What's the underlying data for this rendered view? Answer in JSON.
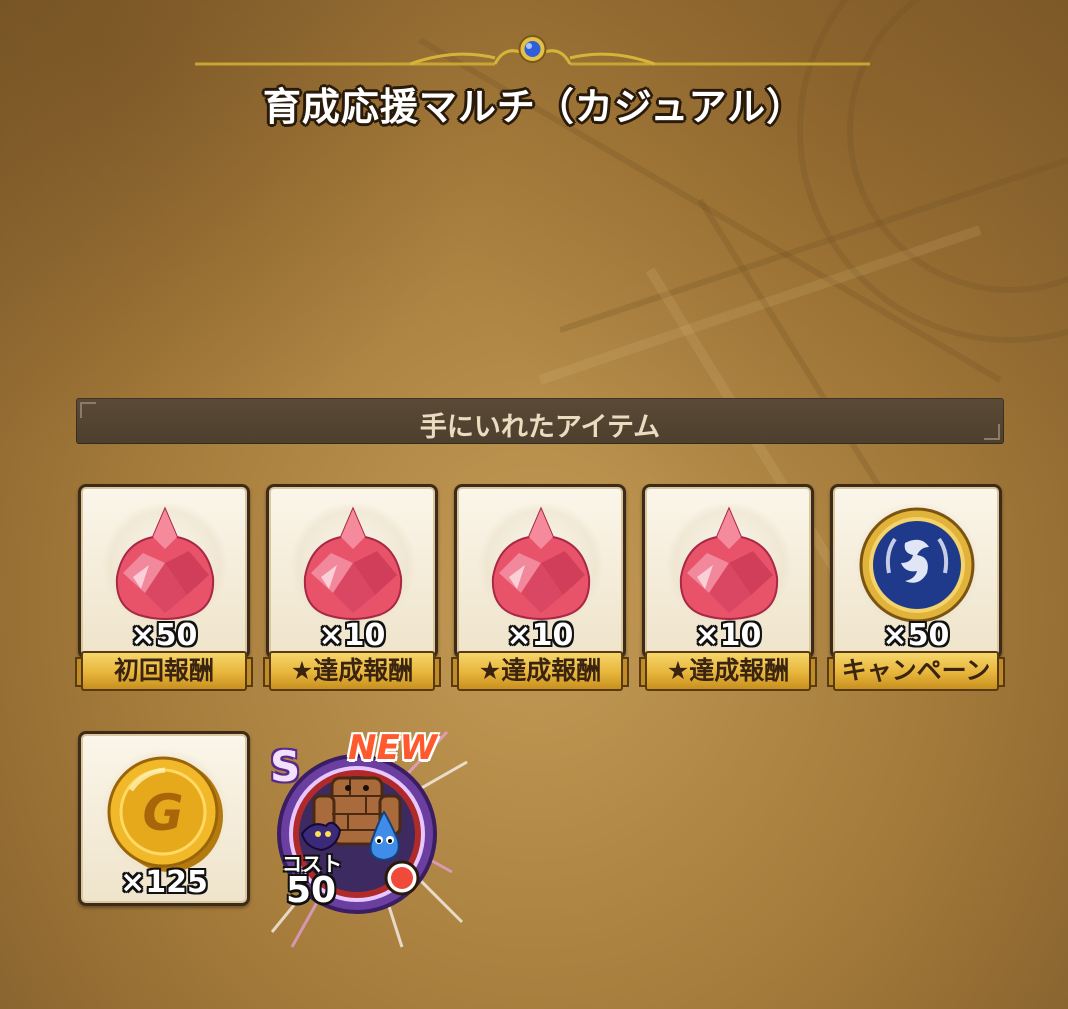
{
  "header": {
    "title": "育成応援マルチ（カジュアル）"
  },
  "section": {
    "title": "手にいれたアイテム"
  },
  "items": [
    {
      "icon": "gem-icon",
      "quantity": "×50",
      "label": "初回報酬"
    },
    {
      "icon": "gem-icon",
      "quantity": "×10",
      "label": "★達成報酬"
    },
    {
      "icon": "gem-icon",
      "quantity": "×10",
      "label": "★達成報酬"
    },
    {
      "icon": "gem-icon",
      "quantity": "×10",
      "label": "★達成報酬"
    },
    {
      "icon": "medal-icon",
      "quantity": "×50",
      "label": "キャンペーン"
    },
    {
      "icon": "gold-coin-icon",
      "quantity": "×125",
      "label": ""
    }
  ],
  "monster": {
    "icon": "golem-monster-icon",
    "rank": "S",
    "new_label": "NEW",
    "cost_label": "コスト",
    "cost_value": "50"
  },
  "colors": {
    "gem": "#e8536a",
    "ribbon": "#e7b53b",
    "medal": "#1f3a8a",
    "gold": "#e6a91c",
    "new": "#ff5a2e"
  }
}
